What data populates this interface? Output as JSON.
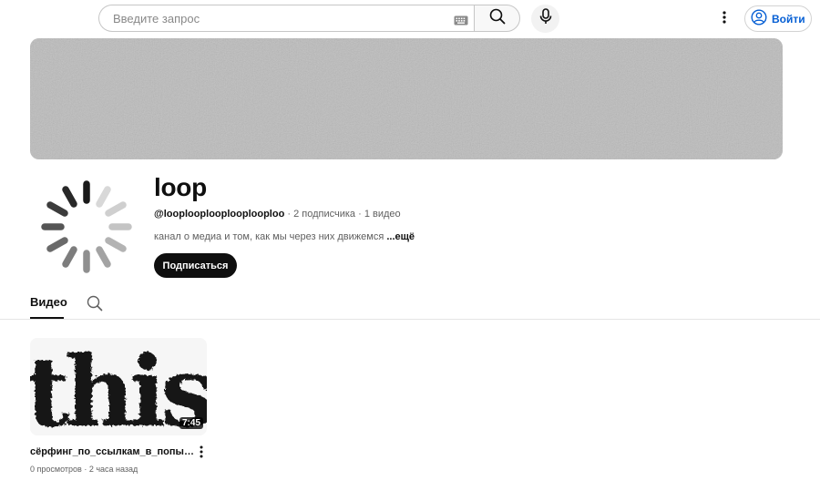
{
  "header": {
    "search_placeholder": "Введите запрос",
    "signin_label": "Войти"
  },
  "channel": {
    "name": "loop",
    "handle": "@looplooplooplooplooploo",
    "subscribers": "2 подписчика",
    "videos_count": "1 видео",
    "separator": "·",
    "description": "канал о медиа и том, как мы через них движемся",
    "more_label": "...ещё",
    "subscribe_label": "Подписаться"
  },
  "tabs": {
    "videos_label": "Видео"
  },
  "video": {
    "thumbnail_text": "this",
    "duration": "7:45",
    "title": "сёрфинг_по_ссылкам_в_попытках_найти_то_что_нужно",
    "views": "0 просмотров",
    "age": "2 часа назад"
  },
  "colors": {
    "accent": "#065fd4",
    "text": "#0f0f0f",
    "secondary_text": "#606060",
    "banner": "#bdbdbd"
  }
}
